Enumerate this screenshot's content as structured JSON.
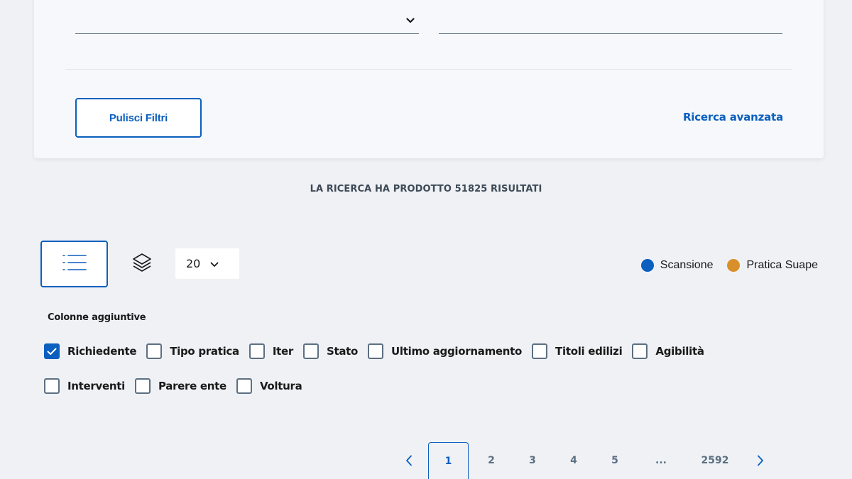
{
  "filters": {
    "clear_label": "Pulisci Filtri",
    "advanced_link": "Ricerca avanzata"
  },
  "results": {
    "summary": "LA RICERCA HA PRODOTTO 51825 RISULTATI"
  },
  "toolbar": {
    "page_size": "20",
    "legend": [
      {
        "label": "Scansione",
        "color": "#0b5fbf"
      },
      {
        "label": "Pratica Suape",
        "color": "#d9902a"
      }
    ]
  },
  "columns": {
    "title": "Colonne aggiuntive",
    "row1": [
      {
        "label": "Richiedente",
        "checked": true
      },
      {
        "label": "Tipo pratica",
        "checked": false
      },
      {
        "label": "Iter",
        "checked": false
      },
      {
        "label": "Stato",
        "checked": false
      },
      {
        "label": "Ultimo aggiornamento",
        "checked": false
      },
      {
        "label": "Titoli edilizi",
        "checked": false
      },
      {
        "label": "Agibilità",
        "checked": false
      }
    ],
    "row2": [
      {
        "label": "Interventi",
        "checked": false
      },
      {
        "label": "Parere ente",
        "checked": false
      },
      {
        "label": "Voltura",
        "checked": false
      }
    ]
  },
  "pagination": {
    "pages": [
      "1",
      "2",
      "3",
      "4",
      "5"
    ],
    "current": "1",
    "ellipsis": "...",
    "last": "2592"
  }
}
